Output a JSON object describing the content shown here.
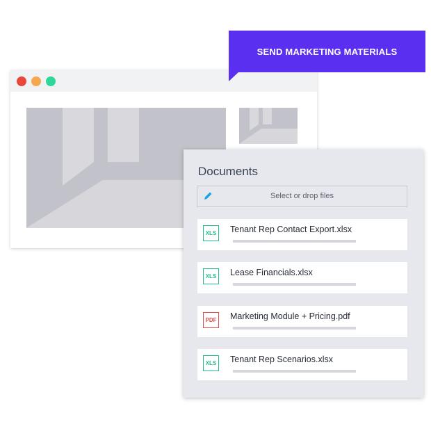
{
  "callout": {
    "label": "SEND MARKETING MATERIALS",
    "color": "#5b2ff0"
  },
  "browser_window": {
    "controls": [
      "close-dot",
      "minimize-dot",
      "maximize-dot"
    ],
    "control_colors": [
      "#e8493a",
      "#f5a94f",
      "#2fd79a"
    ]
  },
  "documents": {
    "title": "Documents",
    "dropzone": {
      "icon": "pencil-icon",
      "label": "Select or drop files"
    },
    "files": [
      {
        "type": "XLS",
        "type_color": "#20c189",
        "name": "Tenant Rep Contact Export.xlsx"
      },
      {
        "type": "XLS",
        "type_color": "#20c189",
        "name": "Lease Financials.xlsx"
      },
      {
        "type": "PDF",
        "type_color": "#e84b4b",
        "name": "Marketing Module + Pricing.pdf"
      },
      {
        "type": "XLS",
        "type_color": "#20c189",
        "name": "Tenant Rep Scenarios.xlsx"
      }
    ]
  }
}
